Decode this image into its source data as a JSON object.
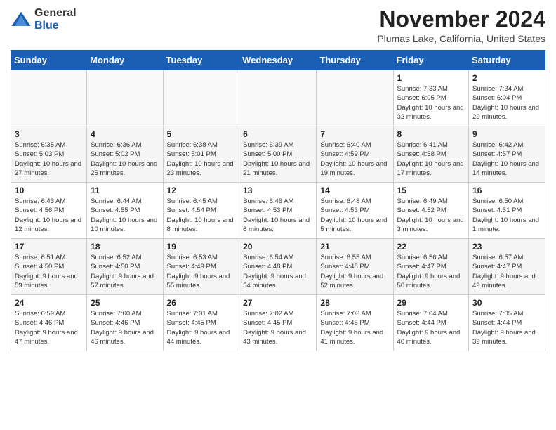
{
  "header": {
    "logo_line1": "General",
    "logo_line2": "Blue",
    "month": "November 2024",
    "location": "Plumas Lake, California, United States"
  },
  "weekdays": [
    "Sunday",
    "Monday",
    "Tuesday",
    "Wednesday",
    "Thursday",
    "Friday",
    "Saturday"
  ],
  "weeks": [
    [
      {
        "day": "",
        "info": ""
      },
      {
        "day": "",
        "info": ""
      },
      {
        "day": "",
        "info": ""
      },
      {
        "day": "",
        "info": ""
      },
      {
        "day": "",
        "info": ""
      },
      {
        "day": "1",
        "info": "Sunrise: 7:33 AM\nSunset: 6:05 PM\nDaylight: 10 hours and 32 minutes."
      },
      {
        "day": "2",
        "info": "Sunrise: 7:34 AM\nSunset: 6:04 PM\nDaylight: 10 hours and 29 minutes."
      }
    ],
    [
      {
        "day": "3",
        "info": "Sunrise: 6:35 AM\nSunset: 5:03 PM\nDaylight: 10 hours and 27 minutes."
      },
      {
        "day": "4",
        "info": "Sunrise: 6:36 AM\nSunset: 5:02 PM\nDaylight: 10 hours and 25 minutes."
      },
      {
        "day": "5",
        "info": "Sunrise: 6:38 AM\nSunset: 5:01 PM\nDaylight: 10 hours and 23 minutes."
      },
      {
        "day": "6",
        "info": "Sunrise: 6:39 AM\nSunset: 5:00 PM\nDaylight: 10 hours and 21 minutes."
      },
      {
        "day": "7",
        "info": "Sunrise: 6:40 AM\nSunset: 4:59 PM\nDaylight: 10 hours and 19 minutes."
      },
      {
        "day": "8",
        "info": "Sunrise: 6:41 AM\nSunset: 4:58 PM\nDaylight: 10 hours and 17 minutes."
      },
      {
        "day": "9",
        "info": "Sunrise: 6:42 AM\nSunset: 4:57 PM\nDaylight: 10 hours and 14 minutes."
      }
    ],
    [
      {
        "day": "10",
        "info": "Sunrise: 6:43 AM\nSunset: 4:56 PM\nDaylight: 10 hours and 12 minutes."
      },
      {
        "day": "11",
        "info": "Sunrise: 6:44 AM\nSunset: 4:55 PM\nDaylight: 10 hours and 10 minutes."
      },
      {
        "day": "12",
        "info": "Sunrise: 6:45 AM\nSunset: 4:54 PM\nDaylight: 10 hours and 8 minutes."
      },
      {
        "day": "13",
        "info": "Sunrise: 6:46 AM\nSunset: 4:53 PM\nDaylight: 10 hours and 6 minutes."
      },
      {
        "day": "14",
        "info": "Sunrise: 6:48 AM\nSunset: 4:53 PM\nDaylight: 10 hours and 5 minutes."
      },
      {
        "day": "15",
        "info": "Sunrise: 6:49 AM\nSunset: 4:52 PM\nDaylight: 10 hours and 3 minutes."
      },
      {
        "day": "16",
        "info": "Sunrise: 6:50 AM\nSunset: 4:51 PM\nDaylight: 10 hours and 1 minute."
      }
    ],
    [
      {
        "day": "17",
        "info": "Sunrise: 6:51 AM\nSunset: 4:50 PM\nDaylight: 9 hours and 59 minutes."
      },
      {
        "day": "18",
        "info": "Sunrise: 6:52 AM\nSunset: 4:50 PM\nDaylight: 9 hours and 57 minutes."
      },
      {
        "day": "19",
        "info": "Sunrise: 6:53 AM\nSunset: 4:49 PM\nDaylight: 9 hours and 55 minutes."
      },
      {
        "day": "20",
        "info": "Sunrise: 6:54 AM\nSunset: 4:48 PM\nDaylight: 9 hours and 54 minutes."
      },
      {
        "day": "21",
        "info": "Sunrise: 6:55 AM\nSunset: 4:48 PM\nDaylight: 9 hours and 52 minutes."
      },
      {
        "day": "22",
        "info": "Sunrise: 6:56 AM\nSunset: 4:47 PM\nDaylight: 9 hours and 50 minutes."
      },
      {
        "day": "23",
        "info": "Sunrise: 6:57 AM\nSunset: 4:47 PM\nDaylight: 9 hours and 49 minutes."
      }
    ],
    [
      {
        "day": "24",
        "info": "Sunrise: 6:59 AM\nSunset: 4:46 PM\nDaylight: 9 hours and 47 minutes."
      },
      {
        "day": "25",
        "info": "Sunrise: 7:00 AM\nSunset: 4:46 PM\nDaylight: 9 hours and 46 minutes."
      },
      {
        "day": "26",
        "info": "Sunrise: 7:01 AM\nSunset: 4:45 PM\nDaylight: 9 hours and 44 minutes."
      },
      {
        "day": "27",
        "info": "Sunrise: 7:02 AM\nSunset: 4:45 PM\nDaylight: 9 hours and 43 minutes."
      },
      {
        "day": "28",
        "info": "Sunrise: 7:03 AM\nSunset: 4:45 PM\nDaylight: 9 hours and 41 minutes."
      },
      {
        "day": "29",
        "info": "Sunrise: 7:04 AM\nSunset: 4:44 PM\nDaylight: 9 hours and 40 minutes."
      },
      {
        "day": "30",
        "info": "Sunrise: 7:05 AM\nSunset: 4:44 PM\nDaylight: 9 hours and 39 minutes."
      }
    ]
  ]
}
